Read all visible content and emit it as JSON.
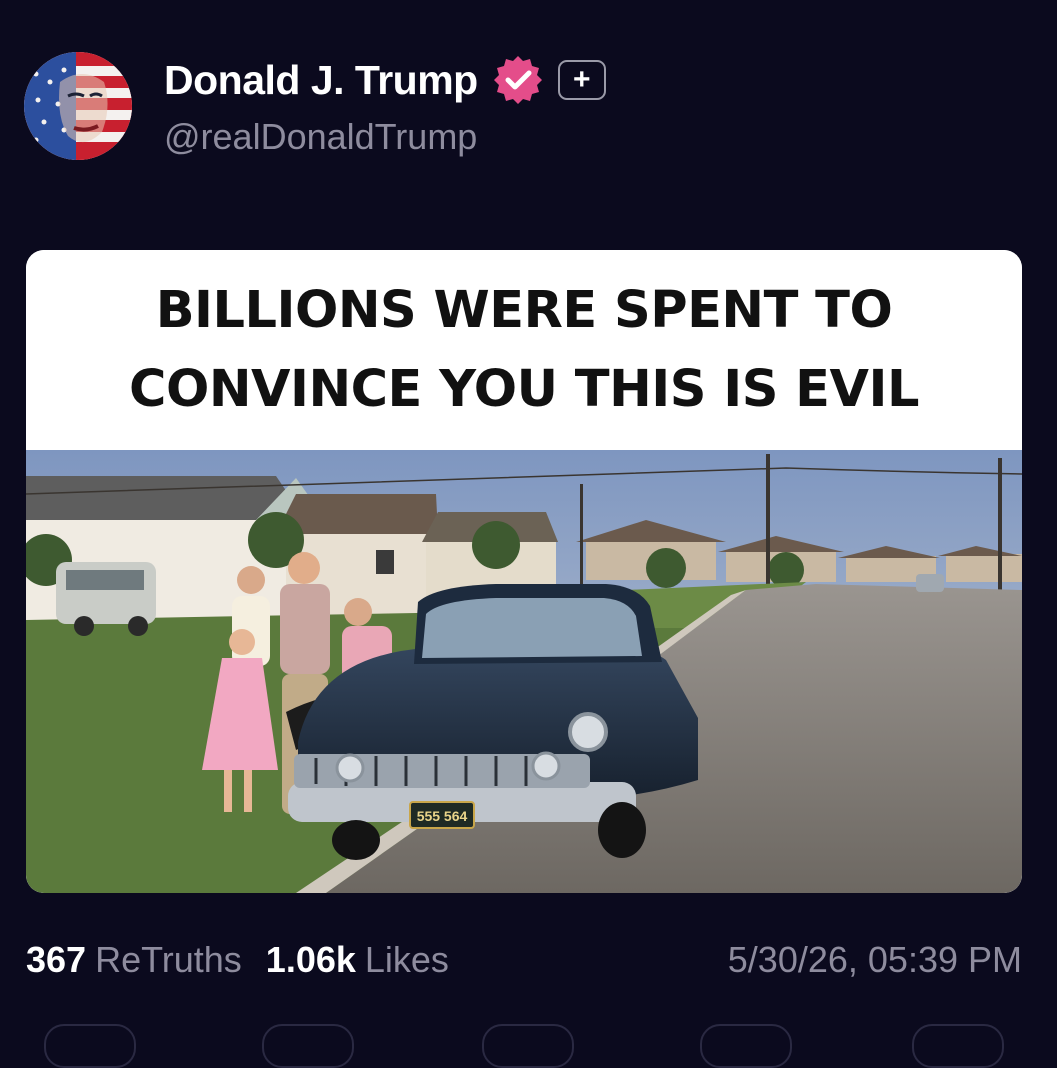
{
  "post": {
    "author": {
      "display_name": "Donald J. Trump",
      "handle": "@realDonaldTrump",
      "verified_icon": "verified-badge-icon",
      "follow_icon": "plus-icon",
      "avatar": "flag-portrait-avatar"
    },
    "image": {
      "caption_line1": "BILLIONS WERE SPENT TO",
      "caption_line2": "CONVINCE YOU THIS IS EVIL",
      "license_plate": "555 564"
    },
    "stats": {
      "retruths_count": "367",
      "retruths_label": "ReTruths",
      "likes_count": "1.06k",
      "likes_label": "Likes"
    },
    "timestamp": "5/30/26, 05:39 PM",
    "follow_label": "+"
  },
  "colors": {
    "background": "#0b0a1e",
    "verified": "#e44d8a",
    "muted_text": "#8e8c9e"
  }
}
